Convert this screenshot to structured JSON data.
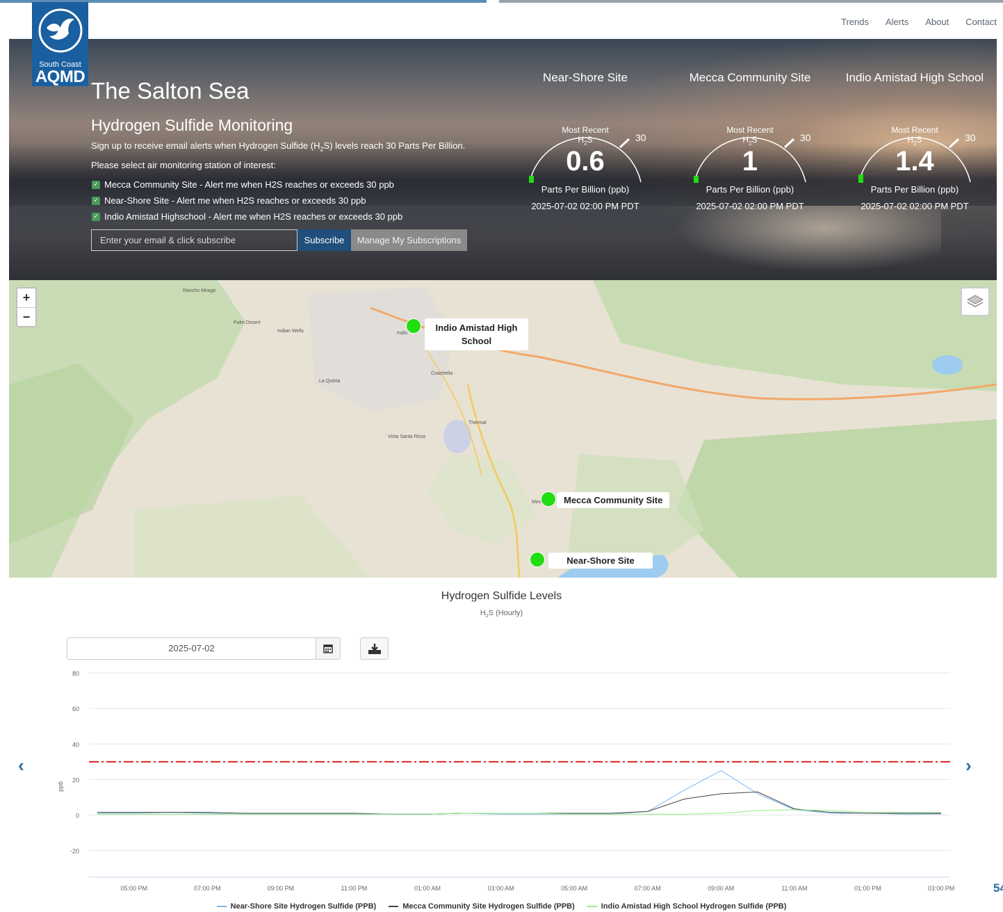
{
  "nav": {
    "links": [
      "Trends",
      "Alerts",
      "About",
      "Contact"
    ]
  },
  "logo": {
    "top": "South Coast",
    "main": "AQMD"
  },
  "hero": {
    "title": "The Salton Sea",
    "subtitle": "Hydrogen Sulfide Monitoring",
    "desc_prefix": "Sign up to receive email alerts when Hydrogen Sulfide (H",
    "desc_sub": "2",
    "desc_suffix": "S) levels reach 30 Parts Per Billion.",
    "select_prompt": "Please select air monitoring station of interest:",
    "checkboxes": [
      {
        "label": "Mecca Community Site - Alert me when H2S reaches or exceeds 30 ppb",
        "checked": true
      },
      {
        "label": "Near-Shore Site - Alert me when H2S reaches or exceeds 30 ppb",
        "checked": true
      },
      {
        "label": "Indio Amistad Highschool - Alert me when H2S reaches or exceeds 30 ppb",
        "checked": true
      }
    ],
    "email_placeholder": "Enter your email & click subscribe",
    "subscribe_label": "Subscribe",
    "manage_label": "Manage My Subscriptions"
  },
  "gauges": [
    {
      "site": "Near-Shore Site",
      "most_recent": "Most Recent",
      "h2s_h": "H",
      "h2s_sub": "2",
      "h2s_s": "S",
      "value": "0.6",
      "max": "30",
      "unit": "Parts Per Billion (ppb)",
      "time": "2025-07-02 02:00 PM PDT",
      "level": 0.6
    },
    {
      "site": "Mecca Community Site",
      "most_recent": "Most Recent",
      "h2s_h": "H",
      "h2s_sub": "2",
      "h2s_s": "S",
      "value": "1",
      "max": "30",
      "unit": "Parts Per Billion (ppb)",
      "time": "2025-07-02 02:00 PM PDT",
      "level": 1
    },
    {
      "site": "Indio Amistad High School",
      "most_recent": "Most Recent",
      "h2s_h": "H",
      "h2s_sub": "2",
      "h2s_s": "S",
      "value": "1.4",
      "max": "30",
      "unit": "Parts Per Billion (ppb)",
      "time": "2025-07-02 02:00 PM PDT",
      "level": 1.4
    }
  ],
  "map": {
    "zoom_in": "+",
    "zoom_out": "−",
    "sites": {
      "indio": "Indio Amistad High School",
      "mecca": "Mecca Community Site",
      "nearshore": "Near-Shore Site"
    },
    "towns": [
      "Rancho Mirage",
      "Palm Desert",
      "Indian Wells",
      "La Quinta",
      "Coachella",
      "Indio",
      "Thermal",
      "Vista Santa Rosa",
      "Mecca"
    ]
  },
  "chart_controls": {
    "date": "2025-07-02",
    "prev_arrow": "‹",
    "next_arrow": "›",
    "page_number": "54"
  },
  "chart_data": {
    "type": "line",
    "title": "Hydrogen Sulfide Levels",
    "subtitle_h": "H",
    "subtitle_sub": "2",
    "subtitle_rest": "S (Hourly)",
    "ylabel": "ppb",
    "ylim": [
      -35,
      80
    ],
    "yticks": [
      80,
      60,
      40,
      20,
      0,
      -20
    ],
    "x_tick_labels": [
      "05:00 PM",
      "07:00 PM",
      "09:00 PM",
      "11:00 PM",
      "01:00 AM",
      "03:00 AM",
      "05:00 AM",
      "07:00 AM",
      "09:00 AM",
      "11:00 AM",
      "01:00 PM",
      "03:00 PM"
    ],
    "threshold": 30,
    "x": [
      "04:00 PM",
      "05:00 PM",
      "06:00 PM",
      "07:00 PM",
      "08:00 PM",
      "09:00 PM",
      "10:00 PM",
      "11:00 PM",
      "12:00 AM",
      "01:00 AM",
      "02:00 AM",
      "03:00 AM",
      "04:00 AM",
      "05:00 AM",
      "06:00 AM",
      "07:00 AM",
      "08:00 AM",
      "09:00 AM",
      "10:00 AM",
      "11:00 AM",
      "12:00 PM",
      "01:00 PM",
      "02:00 PM",
      "03:00 PM"
    ],
    "series": [
      {
        "name": "Near-Shore Site Hydrogen Sulfide (PPB)",
        "color": "#7cb5ec",
        "values": [
          1,
          1,
          1.5,
          1,
          0.5,
          0.5,
          0.5,
          0.5,
          0.5,
          0.5,
          1,
          0.5,
          0.5,
          0.5,
          0.5,
          2,
          14,
          25,
          12,
          3,
          1,
          1,
          0.5,
          0.6
        ]
      },
      {
        "name": "Mecca Community Site Hydrogen Sulfide (PPB)",
        "color": "#434348",
        "values": [
          1.5,
          1.5,
          1.5,
          1.5,
          1,
          1,
          1,
          1,
          0.5,
          0.5,
          1,
          1,
          1,
          1,
          1,
          2,
          9,
          12,
          13,
          3.5,
          1.5,
          1,
          1,
          1
        ]
      },
      {
        "name": "Indio Amistad High School Hydrogen Sulfide (PPB)",
        "color": "#90ed7d",
        "values": [
          0.5,
          0.5,
          0.5,
          0.5,
          0.5,
          0.5,
          0.5,
          0.5,
          0.5,
          0.5,
          1,
          1,
          1,
          0.5,
          0.5,
          0.5,
          0.5,
          1,
          2.5,
          3,
          2.5,
          1.5,
          1.4,
          1.4
        ]
      }
    ]
  }
}
